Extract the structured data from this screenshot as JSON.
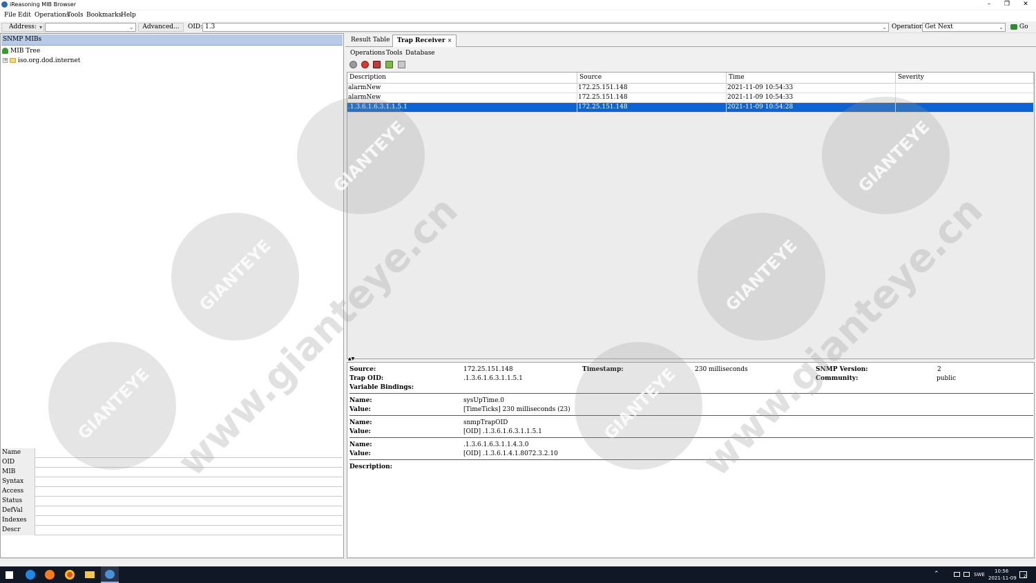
{
  "window": {
    "title": "iReasoning MIB Browser",
    "minimize": "–",
    "maximize": "❐",
    "close": "✕"
  },
  "menu": [
    "File",
    "Edit",
    "Operations",
    "Tools",
    "Bookmarks",
    "Help"
  ],
  "address_bar": {
    "address_label": "Address:",
    "address_value": "",
    "advanced_label": "Advanced...",
    "oid_label": "OID:",
    "oid_value": "1.3",
    "operations_label": "Operations:",
    "operations_value": "Get Next",
    "go_label": "Go"
  },
  "left_panel": {
    "header": "SNMP MIBs",
    "tree_root": "MIB Tree",
    "tree_child": "iso.org.dod.internet",
    "properties": [
      "Name",
      "OID",
      "MIB",
      "Syntax",
      "Access",
      "Status",
      "DefVal",
      "Indexes",
      "Descr"
    ]
  },
  "right_panel": {
    "tabs": [
      {
        "label": "Result Table"
      },
      {
        "label": "Trap Receiver"
      }
    ],
    "tab_close": "×",
    "submenu": [
      "Operations",
      "Tools",
      "Database"
    ],
    "table": {
      "columns": [
        "Description",
        "Source",
        "Time",
        "Severity"
      ],
      "rows": [
        {
          "description": "alarmNew",
          "source": "172.25.151.148",
          "time": "2021-11-09 10:54:33",
          "severity": ""
        },
        {
          "description": "alarmNew",
          "source": "172.25.151.148",
          "time": "2021-11-09 10:54:33",
          "severity": ""
        },
        {
          "description": ".1.3.6.1.6.3.1.1.5.1",
          "source": "172.25.151.148",
          "time": "2021-11-09 10:54:28",
          "severity": ""
        }
      ],
      "selected_row": 2
    },
    "detail": {
      "source_label": "Source:",
      "source_value": "172.25.151.148",
      "timestamp_label": "Timestamp:",
      "timestamp_value": "230 milliseconds",
      "snmp_version_label": "SNMP Version:",
      "snmp_version_value": "2",
      "trap_oid_label": "Trap OID:",
      "trap_oid_value": ".1.3.6.1.6.3.1.1.5.1",
      "community_label": "Community:",
      "community_value": "public",
      "varbinds_label": "Variable Bindings:",
      "bindings": [
        {
          "name_label": "Name:",
          "name": "sysUpTime.0",
          "value_label": "Value:",
          "value": "[TimeTicks] 230 milliseconds (23)"
        },
        {
          "name_label": "Name:",
          "name": "snmpTrapOID",
          "value_label": "Value:",
          "value": "[OID] .1.3.6.1.6.3.1.1.5.1"
        },
        {
          "name_label": "Name:",
          "name": ".1.3.6.1.6.3.1.1.4.3.0",
          "value_label": "Value:",
          "value": "[OID] .1.3.6.1.4.1.8072.3.2.10"
        }
      ],
      "description_label": "Description:"
    }
  },
  "watermark": {
    "brand": "GIANTEYE",
    "url": "www.gianteye.cn"
  },
  "taskbar": {
    "lang": "SWE",
    "time": "10:56",
    "date": "2021-11-09",
    "notif_count": "2"
  },
  "colors": {
    "selection": "#0a64d2",
    "header": "#b8cbe6",
    "taskbar": "#101826"
  }
}
